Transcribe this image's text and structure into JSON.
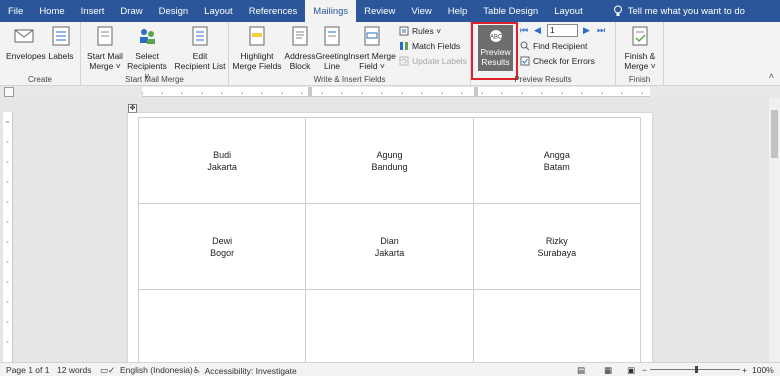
{
  "tabs": [
    "File",
    "Home",
    "Insert",
    "Draw",
    "Design",
    "Layout",
    "References",
    "Mailings",
    "Review",
    "View",
    "Help",
    "Table Design",
    "Layout"
  ],
  "active_tab": "Mailings",
  "tell_me": "Tell me what you want to do",
  "groups": {
    "create": {
      "label": "Create",
      "envelopes": "Envelopes",
      "labels": "Labels"
    },
    "start_mail_merge": {
      "label": "Start Mail Merge",
      "start": "Start Mail Merge",
      "start_l1": "Start Mail",
      "start_l2": "Merge ˅",
      "select_l1": "Select",
      "select_l2": "Recipients ˅",
      "edit_l1": "Edit",
      "edit_l2": "Recipient List"
    },
    "write_insert": {
      "label": "Write & Insert Fields",
      "highlight_l1": "Highlight",
      "highlight_l2": "Merge Fields",
      "address_l1": "Address",
      "address_l2": "Block",
      "greeting_l1": "Greeting",
      "greeting_l2": "Line",
      "insert_l1": "Insert Merge",
      "insert_l2": "Field ˅",
      "rules": "Rules ˅",
      "match_fields": "Match Fields",
      "update_labels": "Update Labels"
    },
    "preview": {
      "label": "Preview Results",
      "preview_l1": "Preview",
      "preview_l2": "Results",
      "record": "1",
      "find_recipient": "Find Recipient",
      "check_errors": "Check for Errors"
    },
    "finish": {
      "label": "Finish",
      "finish_l1": "Finish &",
      "finish_l2": "Merge ˅"
    }
  },
  "labels_table": [
    [
      {
        "name": "Budi",
        "city": "Jakarta"
      },
      {
        "name": "Agung",
        "city": "Bandung"
      },
      {
        "name": "Angga",
        "city": "Batam"
      }
    ],
    [
      {
        "name": "Dewi",
        "city": "Bogor"
      },
      {
        "name": "Dian",
        "city": "Jakarta"
      },
      {
        "name": "Rizky",
        "city": "Surabaya"
      }
    ],
    [
      {
        "name": "",
        "city": ""
      },
      {
        "name": "",
        "city": ""
      },
      {
        "name": "",
        "city": ""
      }
    ]
  ],
  "status": {
    "page": "Page 1 of 1",
    "words": "12 words",
    "language": "English (Indonesia)",
    "accessibility": "Accessibility: Investigate",
    "zoom": "100%"
  },
  "colors": {
    "accent": "#2b579a",
    "highlight": "#e0212e"
  }
}
